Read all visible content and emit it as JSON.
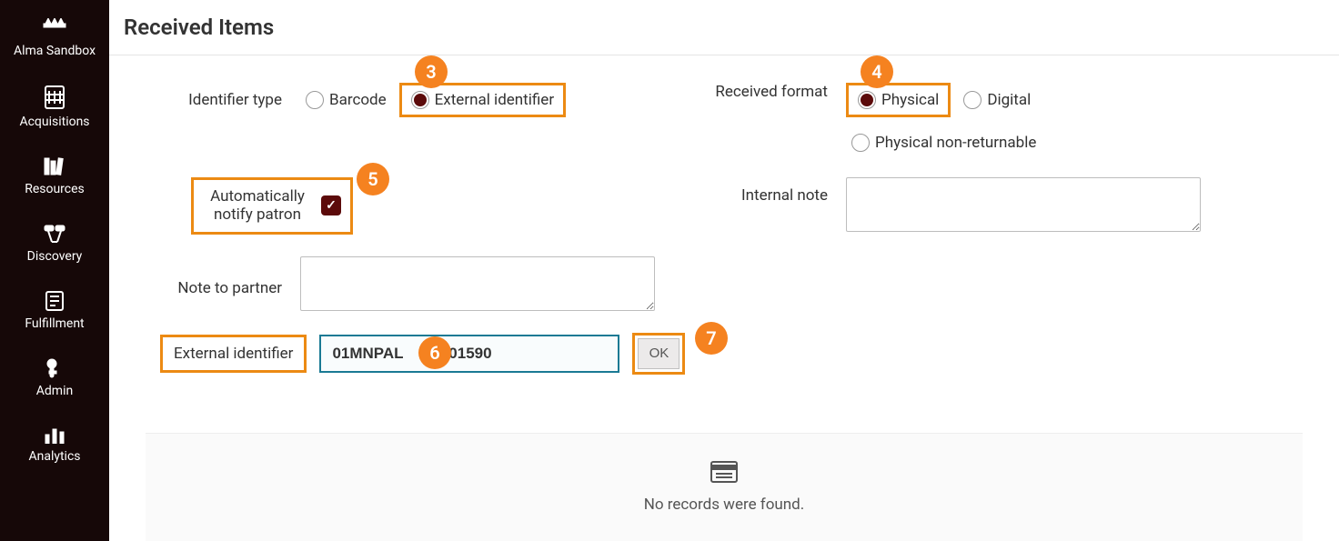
{
  "sidebar": {
    "items": [
      {
        "label": "Alma Sandbox",
        "icon": "alma-sandbox-icon"
      },
      {
        "label": "Acquisitions",
        "icon": "acquisitions-icon"
      },
      {
        "label": "Resources",
        "icon": "resources-icon"
      },
      {
        "label": "Discovery",
        "icon": "discovery-icon"
      },
      {
        "label": "Fulfillment",
        "icon": "fulfillment-icon"
      },
      {
        "label": "Admin",
        "icon": "admin-icon"
      },
      {
        "label": "Analytics",
        "icon": "analytics-icon"
      }
    ]
  },
  "page": {
    "title": "Received Items"
  },
  "form": {
    "identifier_type": {
      "label": "Identifier type",
      "options": {
        "barcode": "Barcode",
        "external": "External identifier"
      },
      "selected": "external"
    },
    "received_format": {
      "label": "Received format",
      "options": {
        "physical": "Physical",
        "digital": "Digital",
        "physical_nr": "Physical non-returnable"
      },
      "selected": "physical"
    },
    "auto_notify": {
      "label": "Automatically notify patron",
      "checked": true
    },
    "internal_note": {
      "label": "Internal note",
      "value": ""
    },
    "note_to_partner": {
      "label": "Note to partner",
      "value": ""
    },
    "external_identifier": {
      "label": "External identifier",
      "value": "01MNPAL    C0001590"
    },
    "ok_button": "OK"
  },
  "results": {
    "empty_message": "No records were found."
  },
  "callouts": {
    "c3": "3",
    "c4": "4",
    "c5": "5",
    "c6": "6",
    "c7": "7"
  },
  "colors": {
    "sidebar_bg": "#160808",
    "accent_dark_red": "#5c0b0b",
    "highlight_orange": "#ec8a13",
    "callout_orange": "#f58220",
    "input_focus_border": "#1a7a94"
  }
}
